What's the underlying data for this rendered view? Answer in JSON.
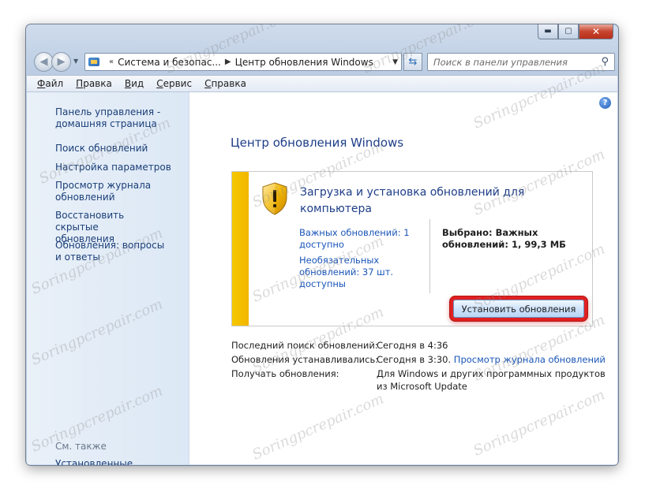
{
  "window": {
    "caption_buttons": {
      "minimize": "▬",
      "maximize": "▢",
      "close": "✕"
    }
  },
  "address_bar": {
    "crumb_sep": "«",
    "breadcrumbs": [
      "Система и безопас...",
      "Центр обновления Windows"
    ],
    "separator": "▶",
    "dropdown_icon": "▼",
    "refresh_icon": "refresh-icon"
  },
  "search": {
    "placeholder": "Поиск в панели управления"
  },
  "menu": [
    {
      "ul": "Ф",
      "rest": "айл"
    },
    {
      "ul": "П",
      "rest": "равка"
    },
    {
      "ul": "В",
      "rest": "ид"
    },
    {
      "ul": "С",
      "rest": "ервис"
    },
    {
      "ul": "С",
      "rest": "правка"
    }
  ],
  "sidebar": {
    "home_link": "Панель управления - домашняя страница",
    "links": [
      "Поиск обновлений",
      "Настройка параметров",
      "Просмотр журнала обновлений",
      "Восстановить скрытые обновления",
      "Обновления: вопросы и ответы"
    ],
    "see_also_label": "См. также",
    "see_also_link": "Установленные обновления"
  },
  "main": {
    "help_glyph": "?",
    "title": "Центр обновления Windows",
    "panel": {
      "heading": "Загрузка и установка обновлений для компьютера",
      "important_link": "Важных обновлений: 1 доступно",
      "optional_link": "Необязательных обновлений: 37 шт. доступны",
      "selected_text": "Выбрано: Важных обновлений: 1, 99,3 МБ",
      "install_button": "Установить обновления",
      "accent_color": "#f4c000",
      "highlight_color": "#e02020"
    },
    "info": {
      "last_search_label": "Последний поиск обновлений:",
      "last_search_value": "Сегодня в 4:36",
      "installed_label": "Обновления устанавливались:",
      "installed_value": "Сегодня в 3:30.",
      "installed_link": "Просмотр журнала обновлений",
      "receive_label": "Получать обновления:",
      "receive_value_1": "Для Windows и других программных продуктов",
      "receive_value_2": "из Microsoft Update"
    }
  },
  "watermark": "Soringpcrepair.com"
}
